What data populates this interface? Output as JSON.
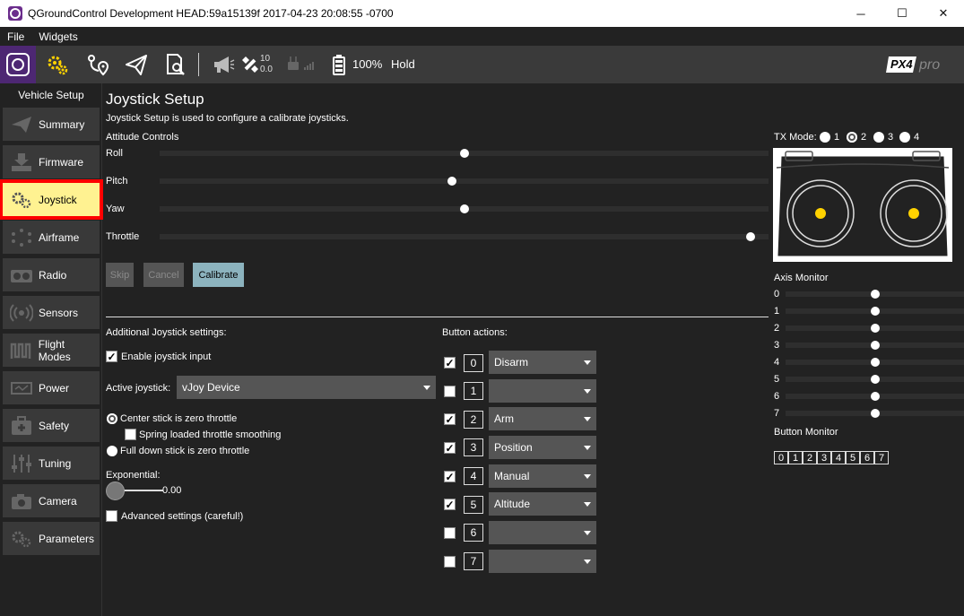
{
  "window": {
    "title": "QGroundControl Development HEAD:59a15139f 2017-04-23 20:08:55 -0700",
    "minimize_glyph": "─",
    "maximize_glyph": "☐",
    "close_glyph": "✕"
  },
  "menu": [
    "File",
    "Widgets"
  ],
  "toolbar": {
    "sat_count": "10",
    "hdop": "0.0",
    "battery": "100%",
    "flight_mode": "Hold",
    "brand": "PX4 pro"
  },
  "sidebar": {
    "title": "Vehicle Setup",
    "items": [
      {
        "label": "Summary",
        "icon": "plane-icon"
      },
      {
        "label": "Firmware",
        "icon": "download-icon"
      },
      {
        "label": "Joystick",
        "icon": "gears-icon",
        "active": true
      },
      {
        "label": "Airframe",
        "icon": "airframe-icon"
      },
      {
        "label": "Radio",
        "icon": "radio-icon"
      },
      {
        "label": "Sensors",
        "icon": "sensors-icon"
      },
      {
        "label": "Flight Modes",
        "icon": "waveform-icon"
      },
      {
        "label": "Power",
        "icon": "battery-icon"
      },
      {
        "label": "Safety",
        "icon": "first-aid-icon"
      },
      {
        "label": "Tuning",
        "icon": "sliders-icon"
      },
      {
        "label": "Camera",
        "icon": "camera-icon"
      },
      {
        "label": "Parameters",
        "icon": "gears-icon"
      }
    ]
  },
  "main": {
    "title": "Joystick Setup",
    "description": "Joystick Setup is used to configure a calibrate joysticks.",
    "attitude_title": "Attitude Controls",
    "controls": [
      {
        "label": "Roll",
        "value": 0.5
      },
      {
        "label": "Pitch",
        "value": 0.48
      },
      {
        "label": "Yaw",
        "value": 0.5
      },
      {
        "label": "Throttle",
        "value": 0.97
      }
    ],
    "buttons": {
      "skip": "Skip",
      "cancel": "Cancel",
      "calibrate": "Calibrate"
    },
    "additional_title": "Additional Joystick settings:",
    "enable_label": "Enable joystick input",
    "enable_checked": true,
    "active_joystick_label": "Active joystick:",
    "active_joystick_value": "vJoy Device",
    "center_stick_label": "Center stick is zero throttle",
    "spring_label": "Spring loaded throttle smoothing",
    "full_down_label": "Full down stick is zero throttle",
    "exponential_label": "Exponential:",
    "exponential_value": "0.00",
    "advanced_label": "Advanced settings (careful!)",
    "button_actions_title": "Button actions:",
    "button_actions": [
      {
        "num": "0",
        "checked": true,
        "action": "Disarm"
      },
      {
        "num": "1",
        "checked": false,
        "action": ""
      },
      {
        "num": "2",
        "checked": true,
        "action": "Arm"
      },
      {
        "num": "3",
        "checked": true,
        "action": "Position"
      },
      {
        "num": "4",
        "checked": true,
        "action": "Manual"
      },
      {
        "num": "5",
        "checked": true,
        "action": "Altitude"
      },
      {
        "num": "6",
        "checked": false,
        "action": ""
      },
      {
        "num": "7",
        "checked": false,
        "action": ""
      }
    ]
  },
  "right": {
    "tx_mode_label": "TX Mode:",
    "tx_modes": [
      "1",
      "2",
      "3",
      "4"
    ],
    "tx_mode_selected": "2",
    "axis_monitor_title": "Axis Monitor",
    "axes": [
      {
        "label": "0",
        "value": 0.5
      },
      {
        "label": "1",
        "value": 0.5
      },
      {
        "label": "2",
        "value": 0.5
      },
      {
        "label": "3",
        "value": 0.5
      },
      {
        "label": "4",
        "value": 0.5
      },
      {
        "label": "5",
        "value": 0.5
      },
      {
        "label": "6",
        "value": 0.5
      },
      {
        "label": "7",
        "value": 0.5
      }
    ],
    "button_monitor_title": "Button Monitor",
    "button_monitor": [
      "0",
      "1",
      "2",
      "3",
      "4",
      "5",
      "6",
      "7"
    ]
  },
  "colors": {
    "active_item_bg": "#fff291",
    "active_outline": "#ff0000",
    "calibrate_bg": "#8cb3be",
    "stick_dot": "#ffd200"
  }
}
